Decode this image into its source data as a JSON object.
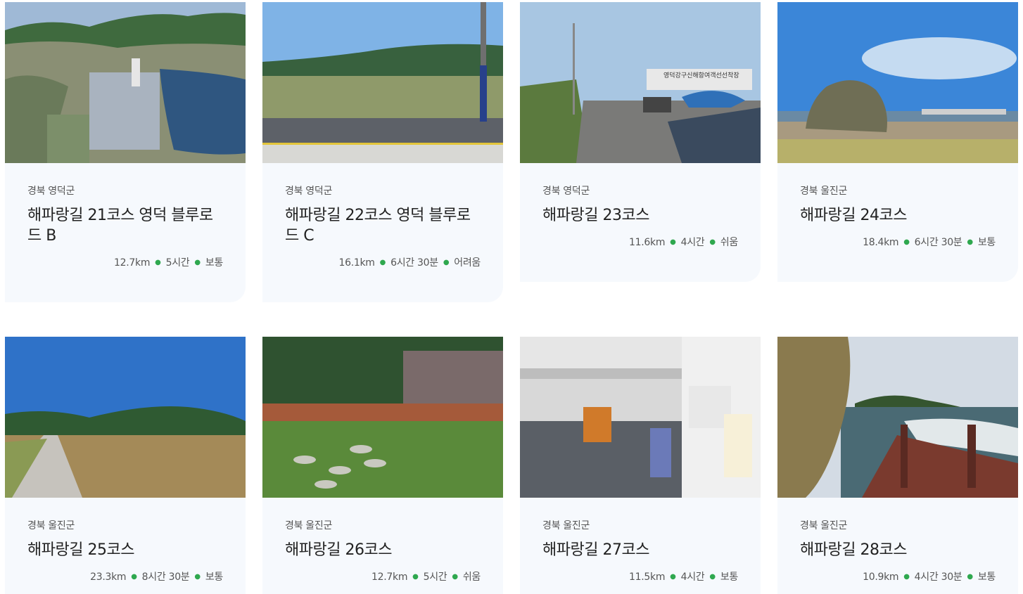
{
  "courses": [
    {
      "region": "경북 영덕군",
      "title": "해파랑길 21코스 영덕 블루로드 B",
      "distance": "12.7km",
      "duration": "5시간",
      "difficulty": "보통"
    },
    {
      "region": "경북 영덕군",
      "title": "해파랑길 22코스 영덕 블루로드 C",
      "distance": "16.1km",
      "duration": "6시간 30분",
      "difficulty": "어려움"
    },
    {
      "region": "경북 영덕군",
      "title": "해파랑길 23코스",
      "distance": "11.6km",
      "duration": "4시간",
      "difficulty": "쉬움"
    },
    {
      "region": "경북 울진군",
      "title": "해파랑길 24코스",
      "distance": "18.4km",
      "duration": "6시간 30분",
      "difficulty": "보통"
    },
    {
      "region": "경북 울진군",
      "title": "해파랑길 25코스",
      "distance": "23.3km",
      "duration": "8시간 30분",
      "difficulty": "보통"
    },
    {
      "region": "경북 울진군",
      "title": "해파랑길 26코스",
      "distance": "12.7km",
      "duration": "5시간",
      "difficulty": "쉬움"
    },
    {
      "region": "경북 울진군",
      "title": "해파랑길 27코스",
      "distance": "11.5km",
      "duration": "4시간",
      "difficulty": "보통"
    },
    {
      "region": "경북 울진군",
      "title": "해파랑길 28코스",
      "distance": "10.9km",
      "duration": "4시간 30분",
      "difficulty": "보통"
    }
  ],
  "photo_sign_text": "영덕강구신해항여객선선착장",
  "colors": {
    "card_bg": "#f6f9fd",
    "dot": "#2fa84f",
    "title": "#222222",
    "text": "#555555"
  }
}
